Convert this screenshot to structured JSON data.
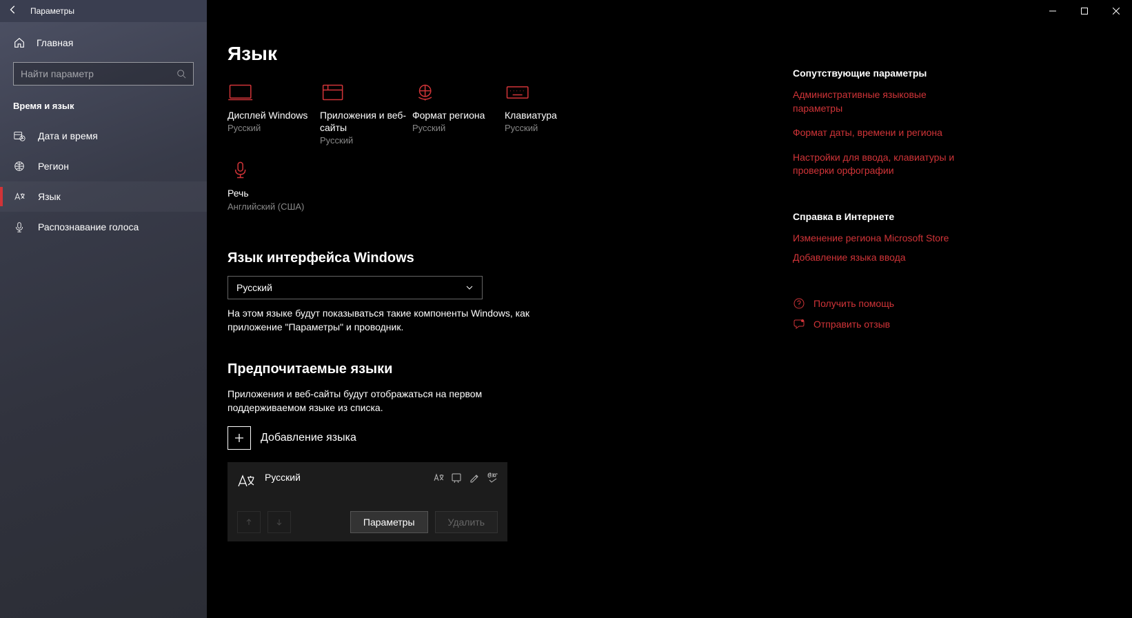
{
  "titlebar": {
    "title": "Параметры"
  },
  "sidebar": {
    "home": "Главная",
    "searchPlaceholder": "Найти параметр",
    "category": "Время и язык",
    "items": [
      {
        "label": "Дата и время"
      },
      {
        "label": "Регион"
      },
      {
        "label": "Язык"
      },
      {
        "label": "Распознавание голоса"
      }
    ]
  },
  "page": {
    "title": "Язык"
  },
  "tiles": [
    {
      "label": "Дисплей Windows",
      "sub": "Русский"
    },
    {
      "label": "Приложения и веб-сайты",
      "sub": "Русский"
    },
    {
      "label": "Формат региона",
      "sub": "Русский"
    },
    {
      "label": "Клавиатура",
      "sub": "Русский"
    },
    {
      "label": "Речь",
      "sub": "Английский (США)"
    }
  ],
  "displayLang": {
    "heading": "Язык интерфейса Windows",
    "selected": "Русский",
    "helper": "На этом языке будут показываться такие компоненты Windows, как приложение \"Параметры\" и проводник."
  },
  "preferred": {
    "heading": "Предпочитаемые языки",
    "desc": "Приложения и веб-сайты будут отображаться на первом поддерживаемом языке из списка.",
    "addLabel": "Добавление языка",
    "langName": "Русский",
    "btnSettings": "Параметры",
    "btnRemove": "Удалить"
  },
  "right": {
    "relatedH": "Сопутствующие параметры",
    "relatedLinks": [
      "Административные языковые параметры",
      "Формат даты, времени и региона",
      "Настройки для ввода, клавиатуры и проверки орфографии"
    ],
    "webH": "Справка в Интернете",
    "webLinks": [
      "Изменение региона Microsoft Store",
      "Добавление языка ввода"
    ],
    "helpLabel": "Получить помощь",
    "feedbackLabel": "Отправить отзыв"
  }
}
